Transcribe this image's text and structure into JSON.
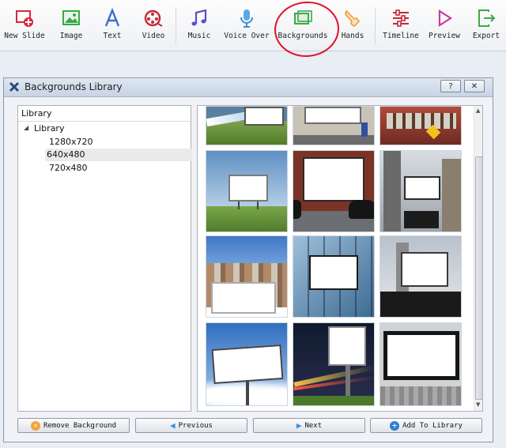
{
  "toolbar": {
    "items": [
      {
        "label": "New Slide",
        "icon": "new-slide-icon"
      },
      {
        "label": "Image",
        "icon": "image-icon"
      },
      {
        "label": "Text",
        "icon": "text-icon"
      },
      {
        "label": "Video",
        "icon": "video-icon"
      },
      {
        "label": "Music",
        "icon": "music-icon"
      },
      {
        "label": "Voice Over",
        "icon": "microphone-icon"
      },
      {
        "label": "Backgrounds",
        "icon": "backgrounds-icon"
      },
      {
        "label": "Hands",
        "icon": "hand-icon"
      },
      {
        "label": "Timeline",
        "icon": "timeline-icon"
      },
      {
        "label": "Preview",
        "icon": "play-icon"
      },
      {
        "label": "Export",
        "icon": "export-icon"
      }
    ]
  },
  "dialog": {
    "title": "Backgrounds Library",
    "help_label": "?",
    "close_label": "✕"
  },
  "tree": {
    "header": "Library",
    "root": "Library",
    "items": [
      "1280x720",
      "640x480",
      "720x480"
    ],
    "selected": "640x480"
  },
  "buttons": {
    "remove": "Remove Background",
    "previous": "Previous",
    "next": "Next",
    "add": "Add To Library"
  },
  "colors": {
    "accent_red": "#e0102a",
    "remove_icon": "#f2a23a",
    "nav_arrow": "#3a8fd8",
    "add_icon": "#2f7fd0"
  }
}
